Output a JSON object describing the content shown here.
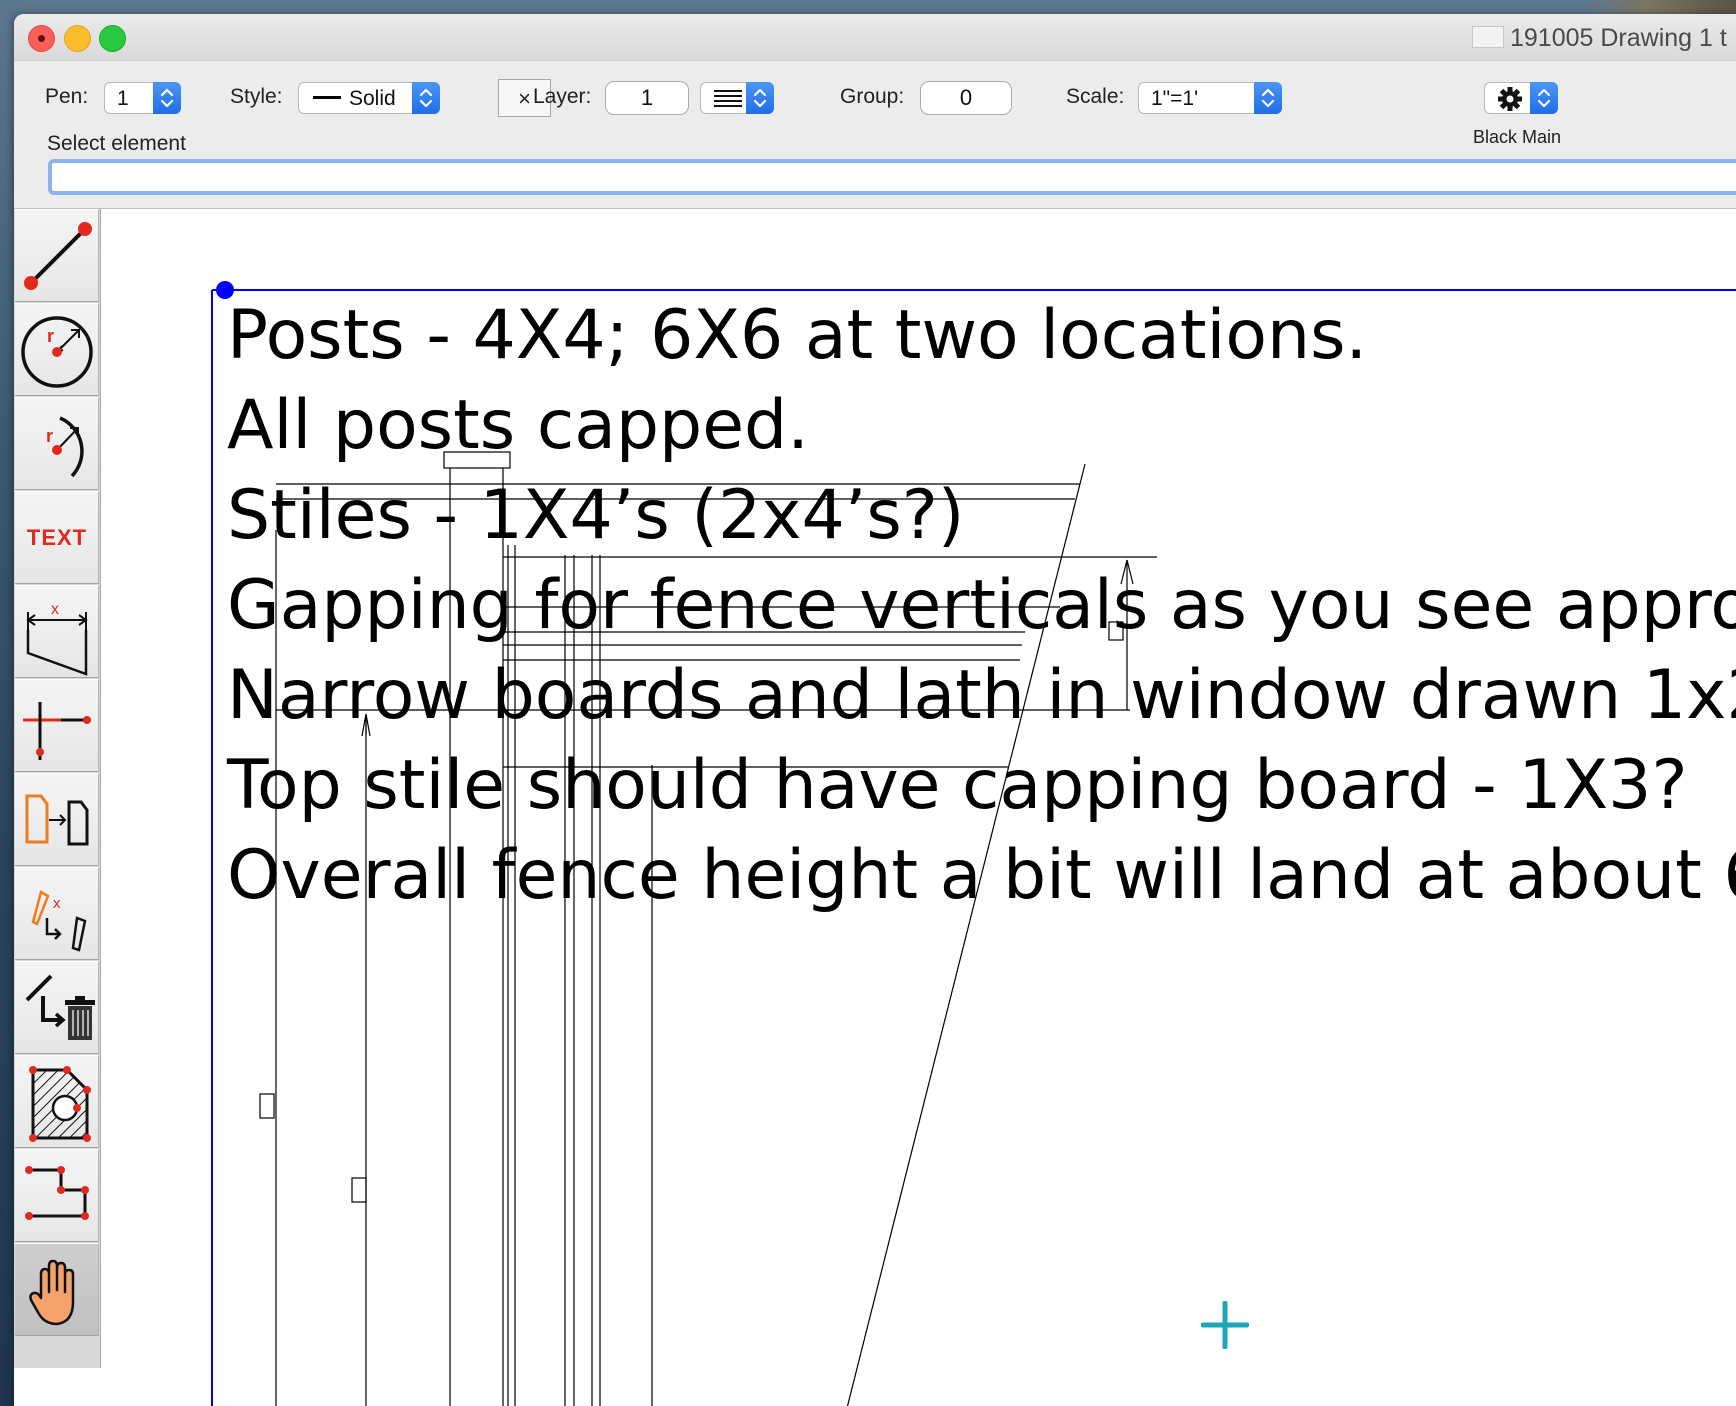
{
  "window": {
    "title": "191005 Drawing 1 t"
  },
  "toolbar": {
    "pen_label": "Pen:",
    "pen_value": "1",
    "style_label": "Style:",
    "style_value": "Solid",
    "clear_button": "×",
    "layer_label": "Layer:",
    "layer_value": "1",
    "group_label": "Group:",
    "group_value": "0",
    "scale_label": "Scale:",
    "scale_value": "1\"=1'",
    "settings_caption": "Black Main",
    "prompt": "Select element",
    "command_value": ""
  },
  "palette": {
    "tools": [
      {
        "name": "line-tool",
        "icon": "line-icon"
      },
      {
        "name": "circle-tool",
        "icon": "circle-radius-icon"
      },
      {
        "name": "arc-tool",
        "icon": "arc-radius-icon"
      },
      {
        "name": "text-tool",
        "icon": "text-icon",
        "label": "TEXT"
      },
      {
        "name": "dimension-tool",
        "icon": "dimension-icon"
      },
      {
        "name": "trim-extend-tool",
        "icon": "trim-icon"
      },
      {
        "name": "copy-move-tool",
        "icon": "copy-move-icon"
      },
      {
        "name": "change-attributes-tool",
        "icon": "pencil-change-icon"
      },
      {
        "name": "delete-tool",
        "icon": "trash-icon"
      },
      {
        "name": "hatch-tool",
        "icon": "hatch-icon"
      },
      {
        "name": "polyline-tool",
        "icon": "polyline-icon"
      },
      {
        "name": "pan-tool",
        "icon": "hand-icon",
        "selected": true
      }
    ]
  },
  "canvas": {
    "notes": [
      "Posts - 4X4; 6X6 at two locations.",
      "All posts capped.",
      "Stiles - 1X4’s  (2x4’s?)",
      "Gapping for fence verticals as you see appro",
      "Narrow boards and lath in window drawn 1x2",
      "Top stile should have capping board - 1X3?",
      "Overall fence height a bit will land at about 6"
    ]
  },
  "colors": {
    "accent_blue": "#1f6ee8",
    "selection_blue": "#0000ff",
    "tool_red": "#e12a1d",
    "cursor_teal": "#1aa6b7"
  }
}
